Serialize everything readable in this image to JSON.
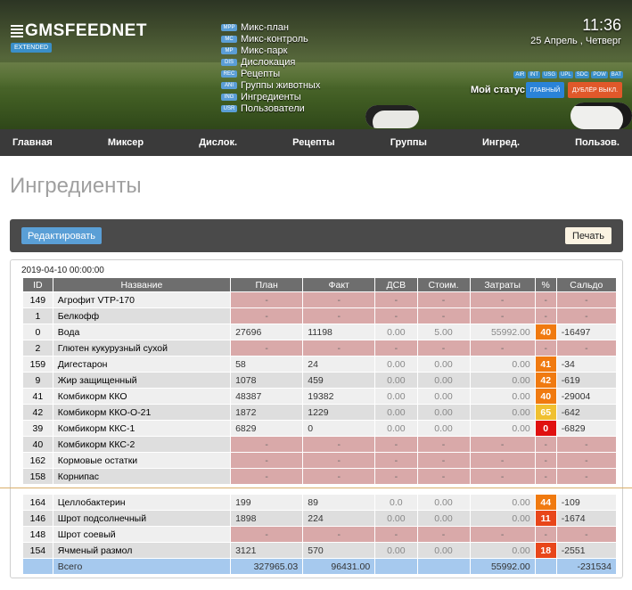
{
  "header": {
    "logo": "GMSFEEDNET",
    "edition": "EXTENDED",
    "time": "11:36",
    "date": "25 Апрель , Четверг",
    "menu": [
      {
        "tag": "MPP",
        "label": "Микс-план"
      },
      {
        "tag": "MC",
        "label": "Микс-контроль"
      },
      {
        "tag": "MP",
        "label": "Микс-парк"
      },
      {
        "tag": "DIS",
        "label": "Дислокация"
      },
      {
        "tag": "REC",
        "label": "Рецепты"
      },
      {
        "tag": "ANI",
        "label": "Группы животных"
      },
      {
        "tag": "ING",
        "label": "Ингредиенты"
      },
      {
        "tag": "USR",
        "label": "Пользователи"
      }
    ],
    "status_tags": [
      "AIR",
      "INT",
      "USG",
      "UPL",
      "SDC",
      "POW",
      "BAT"
    ],
    "my_status": "Мой статус",
    "main_button": "ГЛАВНЫЙ",
    "dup_button": "ДУБЛЁР ВЫКЛ."
  },
  "nav": [
    "Главная",
    "Миксер",
    "Дислок.",
    "Рецепты",
    "Группы",
    "Ингред.",
    "Пользов."
  ],
  "page_title": "Ингредиенты",
  "toolbar": {
    "edit": "Редактировать",
    "print": "Печать"
  },
  "table": {
    "timestamp": "2019-04-10 00:00:00",
    "columns": [
      "ID",
      "Название",
      "План",
      "Факт",
      "ДСВ",
      "Стоим.",
      "Затраты",
      "%",
      "Сальдо"
    ],
    "rows": [
      {
        "id": "149",
        "name": "Агрофит VTP-170",
        "empty": true
      },
      {
        "id": "1",
        "name": "Белкофф",
        "empty": true
      },
      {
        "id": "0",
        "name": "Вода",
        "plan": "27696",
        "fact": "11198",
        "dsv": "0.00",
        "cost": "5.00",
        "spend": "55992.00",
        "pct": "40",
        "saldo": "-16497"
      },
      {
        "id": "2",
        "name": "Глютен кукурузный сухой",
        "empty": true
      },
      {
        "id": "159",
        "name": "Дигестарон",
        "plan": "58",
        "fact": "24",
        "dsv": "0.00",
        "cost": "0.00",
        "spend": "0.00",
        "pct": "41",
        "saldo": "-34"
      },
      {
        "id": "9",
        "name": "Жир защищенный",
        "plan": "1078",
        "fact": "459",
        "dsv": "0.00",
        "cost": "0.00",
        "spend": "0.00",
        "pct": "42",
        "saldo": "-619"
      },
      {
        "id": "41",
        "name": "Комбикорм ККО",
        "plan": "48387",
        "fact": "19382",
        "dsv": "0.00",
        "cost": "0.00",
        "spend": "0.00",
        "pct": "40",
        "saldo": "-29004"
      },
      {
        "id": "42",
        "name": "Комбикорм ККО-О-21",
        "plan": "1872",
        "fact": "1229",
        "dsv": "0.00",
        "cost": "0.00",
        "spend": "0.00",
        "pct": "65",
        "saldo": "-642"
      },
      {
        "id": "39",
        "name": "Комбикорм ККС-1",
        "plan": "6829",
        "fact": "0",
        "dsv": "0.00",
        "cost": "0.00",
        "spend": "0.00",
        "pct": "0",
        "saldo": "-6829"
      },
      {
        "id": "40",
        "name": "Комбикорм ККС-2",
        "empty": true
      },
      {
        "id": "162",
        "name": "Кормовые остатки",
        "empty": true
      },
      {
        "id": "158",
        "name": "Корнипас",
        "empty": true
      },
      {
        "id": "164",
        "name": "Целлобактерин",
        "plan": "199",
        "fact": "89",
        "dsv": "0.0",
        "cost": "0.00",
        "spend": "0.00",
        "pct": "44",
        "saldo": "-109"
      },
      {
        "id": "146",
        "name": "Шрот подсолнечный",
        "plan": "1898",
        "fact": "224",
        "dsv": "0.00",
        "cost": "0.00",
        "spend": "0.00",
        "pct": "11",
        "saldo": "-1674"
      },
      {
        "id": "148",
        "name": "Шрот соевый",
        "empty": true
      },
      {
        "id": "154",
        "name": "Ячменый размол",
        "plan": "3121",
        "fact": "570",
        "dsv": "0.00",
        "cost": "0.00",
        "spend": "0.00",
        "pct": "18",
        "saldo": "-2551"
      }
    ],
    "total": {
      "label": "Всего",
      "plan": "327965.03",
      "fact": "96431.00",
      "spend": "55992.00",
      "saldo": "-231534"
    },
    "empty_marker": "-"
  },
  "colors": {
    "pct_orange": "#f07a10",
    "pct_red_orange": "#e8461a",
    "pct_yellow": "#f0c030",
    "pct_red": "#e01010",
    "pink": "#d9a9a9",
    "total": "#a6c9ee"
  }
}
